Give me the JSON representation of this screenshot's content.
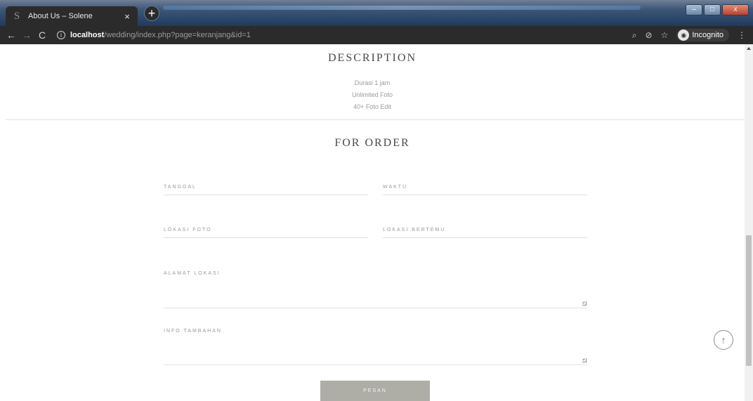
{
  "browser": {
    "tab_title": "About Us – Solene",
    "tab_favicon": "S",
    "tab_close": "×",
    "new_tab": "+",
    "window_controls": {
      "minimize": "–",
      "maximize": "□",
      "close": "x"
    },
    "nav": {
      "back": "←",
      "forward": "→",
      "reload": "C"
    },
    "url_host": "localhost",
    "url_path": "/wedding/index.php?page=keranjang&id=1",
    "info_icon": "i",
    "right_icons": {
      "zoom": "⌕",
      "eye_off": "⊘",
      "star": "☆",
      "menu": "⋮"
    },
    "incognito_label": "Incognito"
  },
  "description": {
    "title": "DESCRIPTION",
    "lines": [
      "Durasi 1 jam",
      "Unlimited Foto",
      "40+ Foto Edit"
    ]
  },
  "order": {
    "title": "FOR ORDER",
    "fields": {
      "tanggal": "TANGGAL",
      "waktu": "WAKTU",
      "lokasi_foto": "LOKASI FOTO",
      "lokasi_bertemu": "LOKASI BERTEMU",
      "alamat_lokasi": "ALAMAT LOKASI",
      "info_tambahan": "INFO TAMBAHAN"
    },
    "submit_label": "PESAN"
  },
  "scroll_top_icon": "↑",
  "colors": {
    "accent_button": "#aeaea6",
    "chrome_dark": "#2b2b2b"
  }
}
